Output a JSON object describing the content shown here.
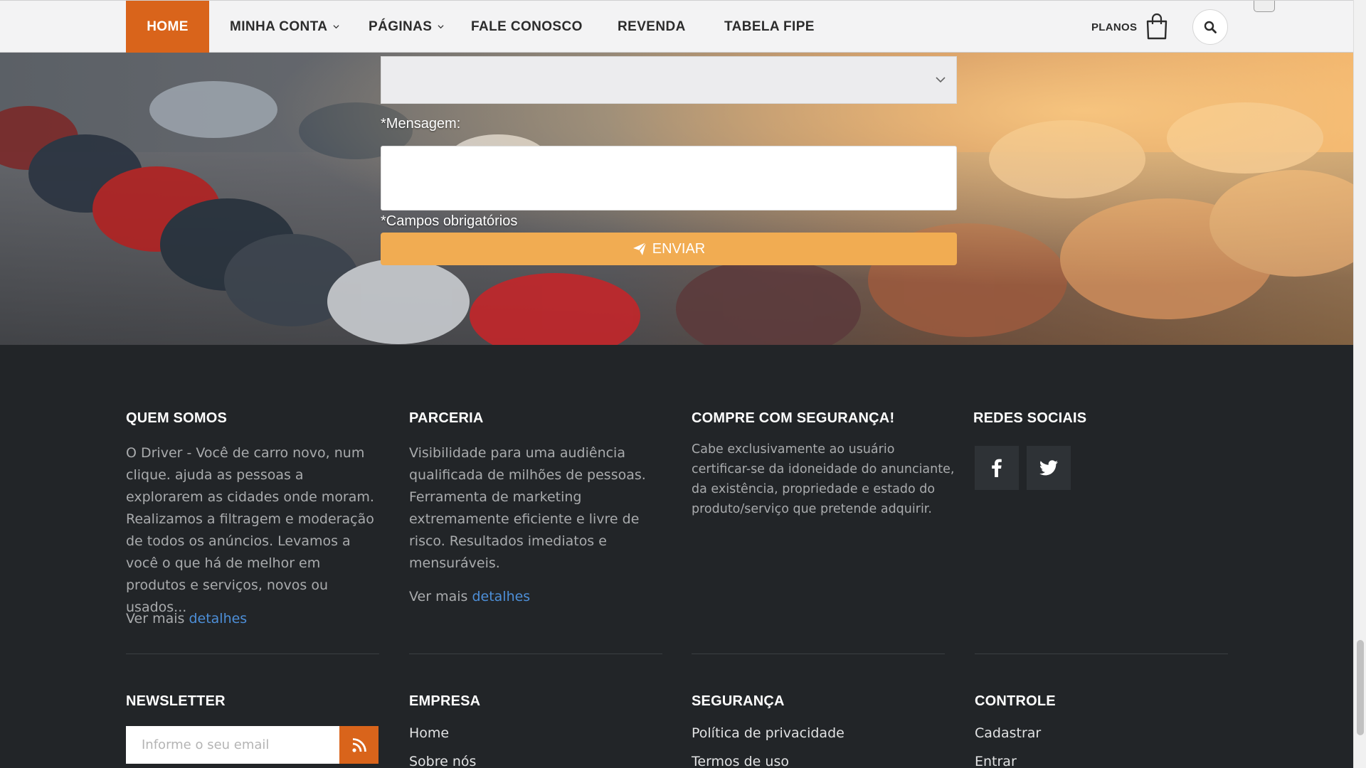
{
  "nav": {
    "items": [
      {
        "label": "HOME",
        "active": true,
        "dropdown": false
      },
      {
        "label": "MINHA CONTA",
        "active": false,
        "dropdown": true
      },
      {
        "label": "PÁGINAS",
        "active": false,
        "dropdown": true
      },
      {
        "label": "FALE CONOSCO",
        "active": false,
        "dropdown": false
      },
      {
        "label": "REVENDA",
        "active": false,
        "dropdown": false
      },
      {
        "label": "TABELA FIPE",
        "active": false,
        "dropdown": false
      }
    ],
    "planos_label": "PLANOS",
    "accent_color": "#d9641b"
  },
  "form": {
    "select_value": "",
    "message_label": "*Mensagem:",
    "message_value": "",
    "required_note": "*Campos obrigatórios",
    "submit_label": "ENVIAR",
    "submit_color": "#f1ac52"
  },
  "footer": {
    "quem_somos": {
      "title": "QUEM SOMOS",
      "text": "O Driver - Você de carro novo, num clique. ajuda as pessoas a explorarem as cidades onde moram. Realizamos a filtragem e moderação de todos os anúncios. Levamos a você o que há de melhor em produtos e serviços, novos ou usados...",
      "more_prefix": "Ver mais",
      "more_link": "detalhes"
    },
    "parceria": {
      "title": "PARCERIA",
      "text": "Visibilidade para uma audiência qualificada de milhões de pessoas. Ferramenta de marketing extremamente eficiente e livre de risco. Resultados imediatos e mensuráveis.",
      "more_prefix": "Ver mais",
      "more_link": "detalhes"
    },
    "seguranca_info": {
      "title": "COMPRE COM SEGURANÇA!",
      "text": "Cabe exclusivamente ao usuário certificar-se da idoneidade do anunciante, da existência, propriedade e estado do produto/serviço que pretende adquirir."
    },
    "redes_sociais": {
      "title": "REDES SOCIAIS",
      "icons": [
        "facebook-icon",
        "twitter-icon"
      ]
    },
    "newsletter": {
      "title": "NEWSLETTER",
      "placeholder": "Informe o seu email"
    },
    "empresa": {
      "title": "EMPRESA",
      "links": [
        "Home",
        "Sobre nós"
      ]
    },
    "seguranca": {
      "title": "SEGURANÇA",
      "links": [
        "Política de privacidade",
        "Termos de uso"
      ]
    },
    "controle": {
      "title": "CONTROLE",
      "links": [
        "Cadastrar",
        "Entrar"
      ]
    },
    "link_color": "#4d8fd8",
    "bg_color": "#222528"
  }
}
